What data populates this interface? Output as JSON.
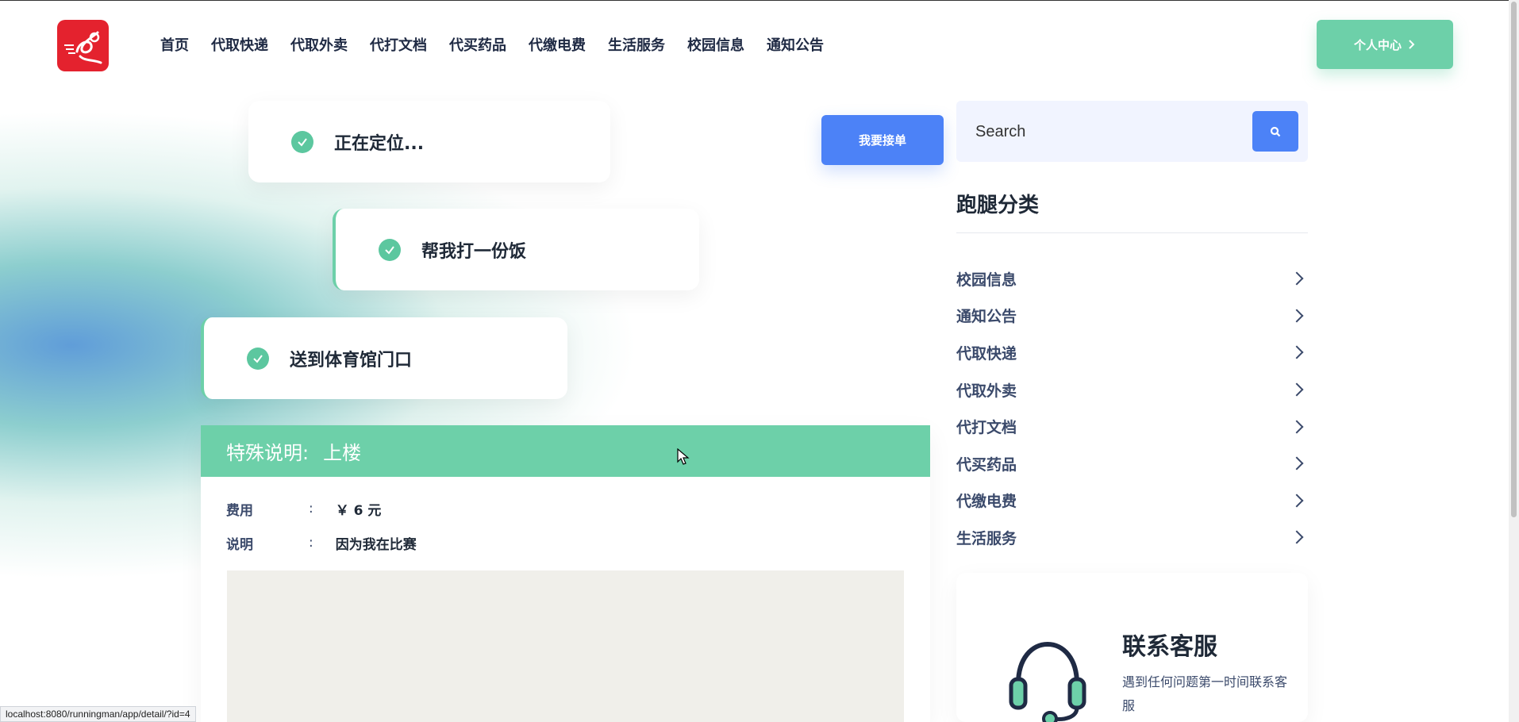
{
  "header": {
    "logo_icon": "running-man-logo",
    "nav": [
      "首页",
      "代取快递",
      "代取外卖",
      "代打文档",
      "代买药品",
      "代缴电费",
      "生活服务",
      "校园信息",
      "通知公告"
    ],
    "profile_label": "个人中心"
  },
  "steps": [
    "正在定位...",
    "帮我打一份饭",
    "送到体育馆门口"
  ],
  "accept_label": "我要接单",
  "detail": {
    "head_label": "特殊说明:",
    "head_value": "上楼",
    "fee_key": "费用",
    "fee_value": "￥ 6 元",
    "desc_key": "说明",
    "desc_value": "因为我在比赛",
    "colon": ":"
  },
  "sidebar": {
    "search_placeholder": "Search",
    "category_title": "跑腿分类",
    "categories": [
      "校园信息",
      "通知公告",
      "代取快递",
      "代取外卖",
      "代打文档",
      "代买药品",
      "代缴电费",
      "生活服务"
    ],
    "service_title": "联系客服",
    "service_desc": "遇到任何问题第一时间联系客服"
  },
  "status_url": "localhost:8080/runningman/app/detail/?id=4",
  "colors": {
    "accent_green": "#6dd0a9",
    "accent_blue": "#4c82f7",
    "logo_red": "#e4222e"
  }
}
